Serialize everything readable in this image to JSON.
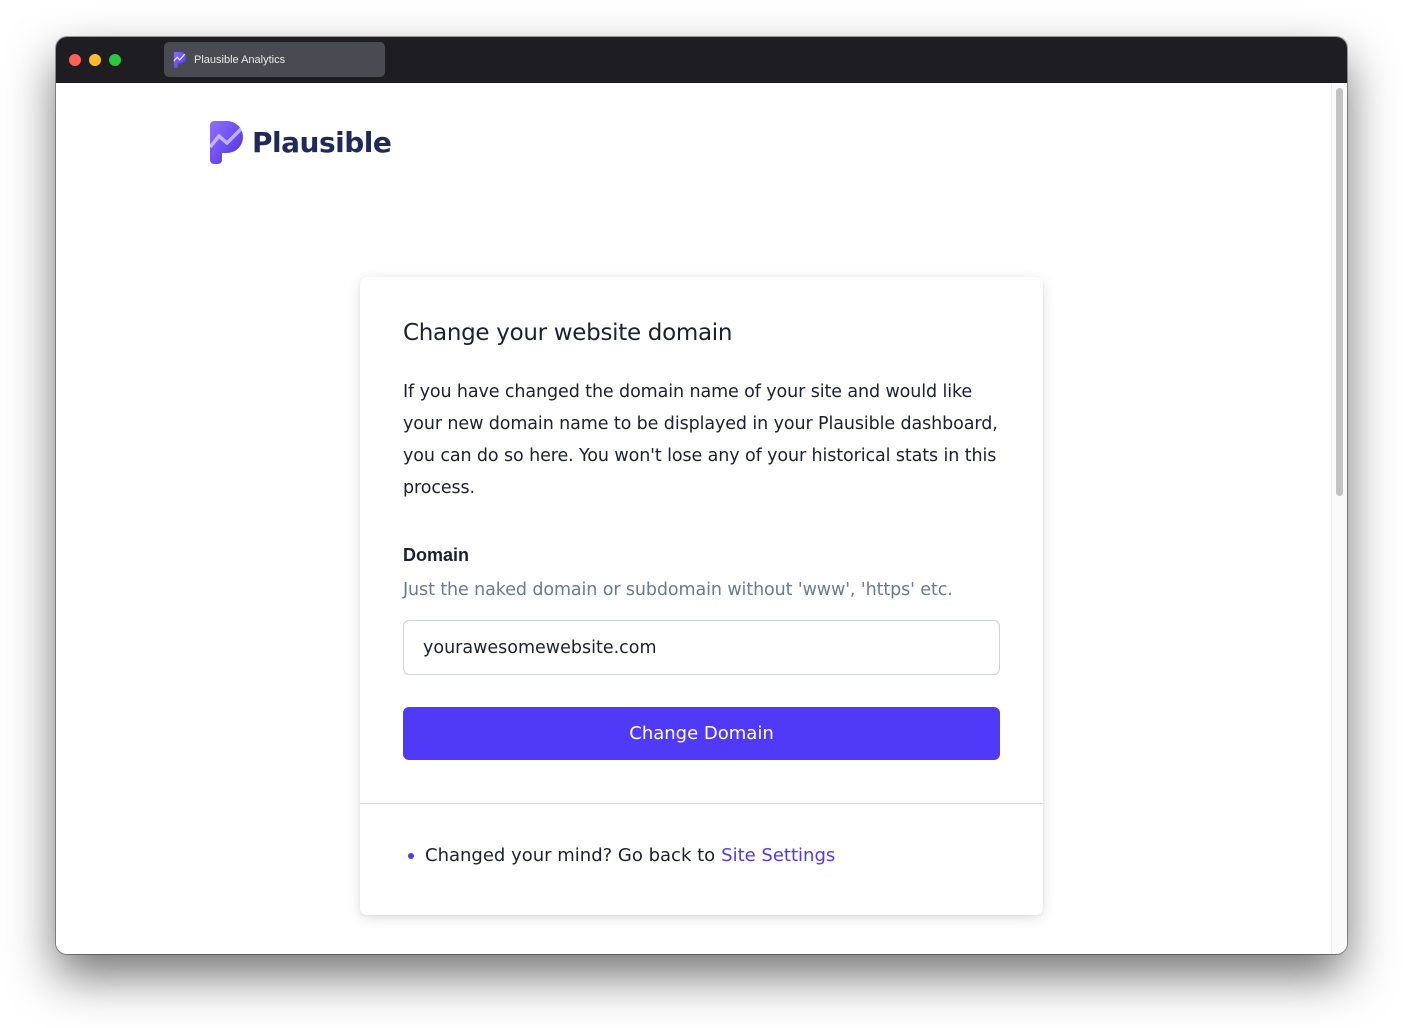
{
  "browser": {
    "tab_title": "Plausible Analytics",
    "tab_icon": "plausible-logo-icon"
  },
  "header": {
    "logo_text": "Plausible"
  },
  "card": {
    "heading": "Change your website domain",
    "description": "If you have changed the domain name of your site and would like your new domain name to be displayed in your Plausible dashboard, you can do so here. You won't lose any of your historical stats in this process.",
    "domain_label": "Domain",
    "domain_help": "Just the naked domain or subdomain without 'www', 'https' etc.",
    "domain_value": "yourawesomewebsite.com",
    "submit_label": "Change Domain",
    "footer_text": "Changed your mind? Go back to",
    "footer_link_label": "Site Settings"
  },
  "colors": {
    "accent": "#5039f7",
    "brand_dark": "#1f2a5a",
    "text": "#1c2030",
    "muted": "#6b7a90"
  }
}
